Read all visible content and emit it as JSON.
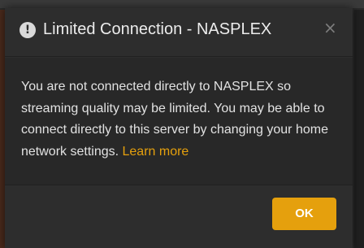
{
  "dialog": {
    "title": "Limited Connection - NASPLEX",
    "icon": "exclamation-circle-icon",
    "close_glyph": "×",
    "body_text": "You are not connected directly to NASPLEX so streaming quality may be limited. You may be able to connect directly to this server by changing your home network settings. ",
    "learn_more_label": "Learn more",
    "ok_label": "OK"
  },
  "colors": {
    "accent": "#e5a00d",
    "dialog_background": "#2d2d2d",
    "body_background": "#282828",
    "text": "#e2e2e2"
  }
}
